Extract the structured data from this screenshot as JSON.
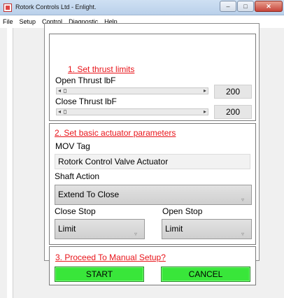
{
  "window": {
    "title": "Rotork Controls Ltd - Enlight.",
    "min_label": "–",
    "max_label": "□",
    "close_label": "✕"
  },
  "menu": [
    "File",
    "Setup",
    "Control",
    "Diagnostic",
    "Help"
  ],
  "section1": {
    "heading": "1. Set thrust limits",
    "open_label": "Open  Thrust lbF",
    "open_value": "200",
    "close_label": "Close  Thrust lbF",
    "close_value": "200",
    "slider_left": "◂",
    "slider_right": "▸"
  },
  "section2": {
    "heading": "2. Set basic actuator parameters",
    "mov_tag_label": "MOV Tag",
    "mov_tag_value": "Rotork Control Valve Actuator",
    "shaft_action_label": "Shaft Action",
    "shaft_action_value": "Extend To Close",
    "close_stop_label": "Close Stop",
    "close_stop_value": "Limit",
    "open_stop_label": "Open Stop",
    "open_stop_value": "Limit",
    "chevron": "▿"
  },
  "section3": {
    "heading": "3. Proceed To Manual Setup?",
    "start_label": "START",
    "cancel_label": "CANCEL"
  },
  "colors": {
    "heading": "#e8141a",
    "button_green": "#39e63a"
  }
}
